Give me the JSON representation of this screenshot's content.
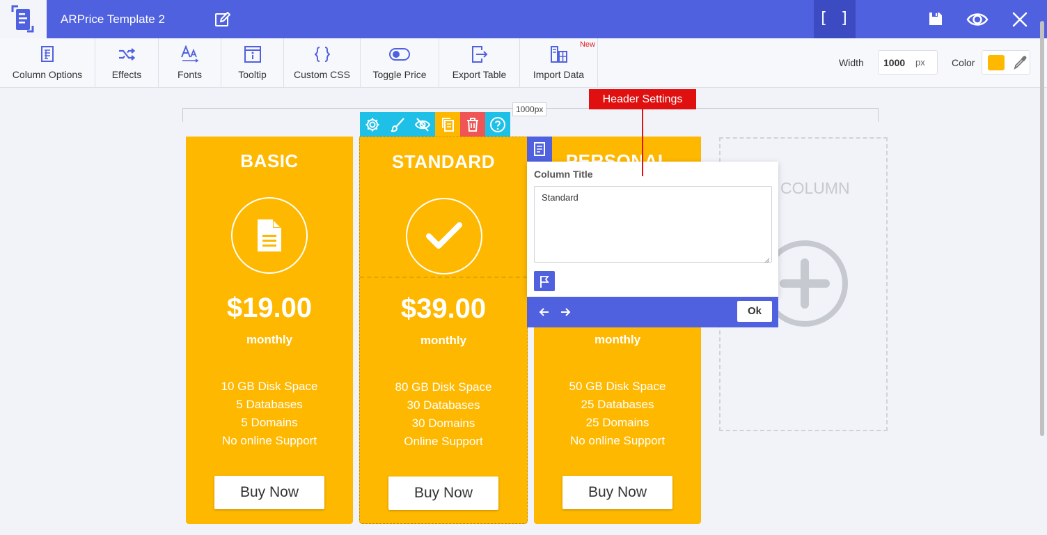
{
  "app": {
    "title": "ARPrice Template 2",
    "bracket_label": "[ ]",
    "accent_color": "#5061e0"
  },
  "toolbar": {
    "tools": [
      {
        "label": "Column Options",
        "icon": "column-options-icon"
      },
      {
        "label": "Effects",
        "icon": "shuffle-icon"
      },
      {
        "label": "Fonts",
        "icon": "fonts-icon"
      },
      {
        "label": "Tooltip",
        "icon": "tooltip-icon"
      },
      {
        "label": "Custom CSS",
        "icon": "braces-icon"
      },
      {
        "label": "Toggle Price",
        "icon": "toggle-icon"
      },
      {
        "label": "Export Table",
        "icon": "export-icon"
      },
      {
        "label": "Import Data",
        "icon": "import-icon",
        "badge": "New"
      }
    ],
    "width_label": "Width",
    "width_value": "1000",
    "width_unit": "px",
    "color_label": "Color",
    "color_value": "#ffb800"
  },
  "canvas": {
    "ruler_label": "1000px",
    "columns": [
      {
        "title": "BASIC",
        "icon": "document-icon",
        "price": "$19.00",
        "period": "monthly",
        "features": [
          "10 GB Disk Space",
          "5 Databases",
          "5 Domains",
          "No online Support"
        ],
        "button": "Buy Now"
      },
      {
        "title": "STANDARD",
        "icon": "checkmark-icon",
        "price": "$39.00",
        "period": "monthly",
        "features": [
          "80 GB Disk Space",
          "30 Databases",
          "30 Domains",
          "Online Support"
        ],
        "button": "Buy Now"
      },
      {
        "title": "PERSONAL",
        "price": "",
        "period": "monthly",
        "features": [
          "50 GB Disk Space",
          "25 Databases",
          "25 Domains",
          "No online Support"
        ],
        "button": "Buy Now"
      }
    ],
    "add_column_label": "D COLUMN",
    "column_color": "#ffb800"
  },
  "header_settings": {
    "callout": "Header Settings",
    "field_label": "Column Title",
    "field_value": "Standard",
    "ok_label": "Ok"
  }
}
